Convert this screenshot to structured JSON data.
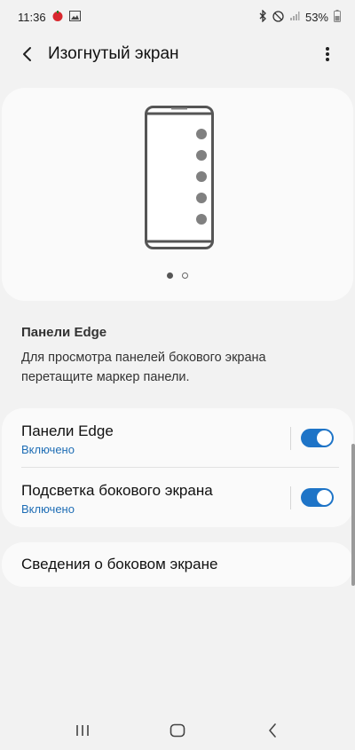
{
  "status": {
    "time": "11:36",
    "battery": "53%",
    "icons_left": [
      "notification-icon",
      "image-icon"
    ],
    "icons_right": [
      "bluetooth-icon",
      "do-not-disturb-icon",
      "signal-icon",
      "battery-icon"
    ]
  },
  "header": {
    "title": "Изогнутый экран"
  },
  "illustration": {
    "dot_count": 5,
    "page_count": 2,
    "active_page": 0
  },
  "description": {
    "title": "Панели Edge",
    "text": "Для просмотра панелей бокового экрана перетащите маркер панели."
  },
  "settings": [
    {
      "label": "Панели Edge",
      "status": "Включено",
      "enabled": true
    },
    {
      "label": "Подсветка бокового экрана",
      "status": "Включено",
      "enabled": true
    }
  ],
  "info": {
    "label": "Сведения о боковом экране"
  },
  "colors": {
    "accent": "#1e74c7",
    "status_text": "#1e6db5",
    "background": "#f2f2f2",
    "card": "#fafafa"
  }
}
